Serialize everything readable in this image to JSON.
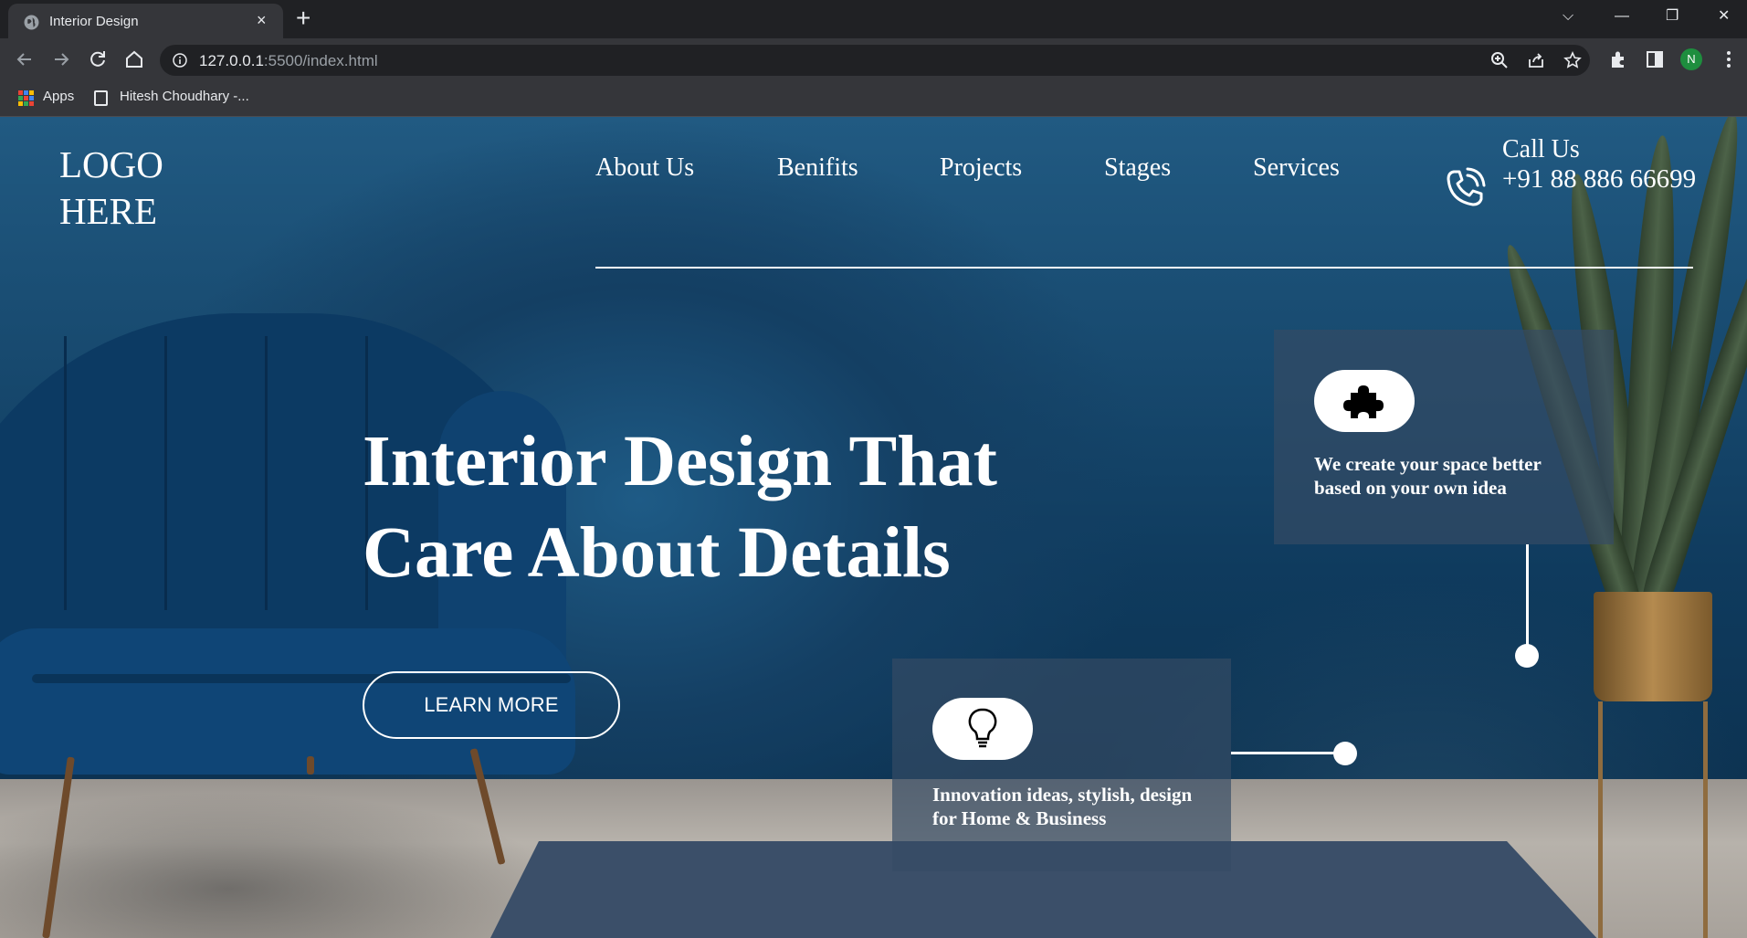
{
  "browser": {
    "tab_title": "Interior Design",
    "tab_close": "×",
    "new_tab": "+",
    "url_host": "127.0.0.1",
    "url_rest": ":5500/index.html",
    "profile_initial": "N",
    "window_controls": {
      "dropdown": "⌵",
      "minimize": "—",
      "restore": "❐",
      "close": "✕"
    },
    "bookmarks": [
      {
        "label": "Apps",
        "icon": "apps-grid-icon"
      },
      {
        "label": "Hitesh Choudhary -...",
        "icon": "page-icon"
      }
    ]
  },
  "page": {
    "logo": {
      "line1": "LOGO",
      "line2": "HERE"
    },
    "nav": [
      {
        "label": "About Us"
      },
      {
        "label": "Benifits"
      },
      {
        "label": "Projects"
      },
      {
        "label": "Stages"
      },
      {
        "label": "Services"
      }
    ],
    "contact": {
      "title": "Call Us",
      "number": "+91 88 886 66699",
      "icon": "phone-icon"
    },
    "hero": {
      "title_line1": "Interior Design That",
      "title_line2": "Care About Details",
      "button_label": "LEARN MORE"
    },
    "features": [
      {
        "icon": "puzzle-icon",
        "line1": "We create your space better",
        "line2": "based on your own idea"
      },
      {
        "icon": "lightbulb-icon",
        "line1": "Innovation ideas, stylish, design",
        "line2": "for Home & Business"
      }
    ]
  },
  "colors": {
    "accent": "#ffffff",
    "hero_bg": "#15426a",
    "card_bg": "#354b64"
  }
}
